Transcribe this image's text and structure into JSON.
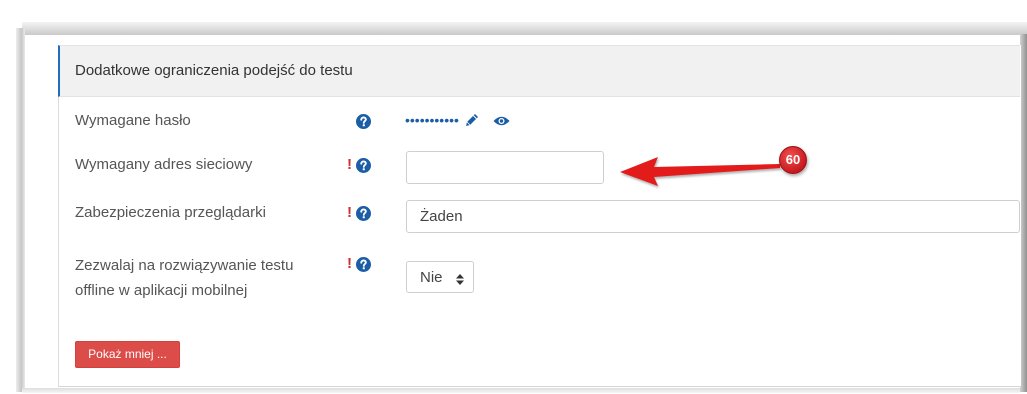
{
  "section": {
    "title": "Dodatkowe ograniczenia podejść do testu",
    "accent_color": "#1f6cc0"
  },
  "advanced_marker": "!",
  "fields": {
    "password": {
      "label": "Wymagane hasło",
      "masked_value": "•••••••••••"
    },
    "subnet": {
      "label": "Wymagany adres sieciowy",
      "value": ""
    },
    "browser_security": {
      "label": "Zabezpieczenia przeglądarki",
      "selected": "Żaden"
    },
    "allow_offline": {
      "label": "Zezwalaj na rozwiązywanie testu offline w aplikacji mobilnej",
      "selected": "Nie"
    }
  },
  "show_less_button": {
    "label": "Pokaż mniej ..."
  },
  "callout": {
    "badge": "60",
    "color": "#e31b1b"
  },
  "icons": {
    "help": "question-circle-icon",
    "edit": "pencil-icon",
    "reveal": "eye-icon",
    "select_caret": "up-down-caret-icon"
  },
  "colors": {
    "icon_blue": "#1b5ea6",
    "advanced_red": "#c9302c",
    "button_red": "#dc4c48",
    "header_bg": "#f1f1f1"
  }
}
